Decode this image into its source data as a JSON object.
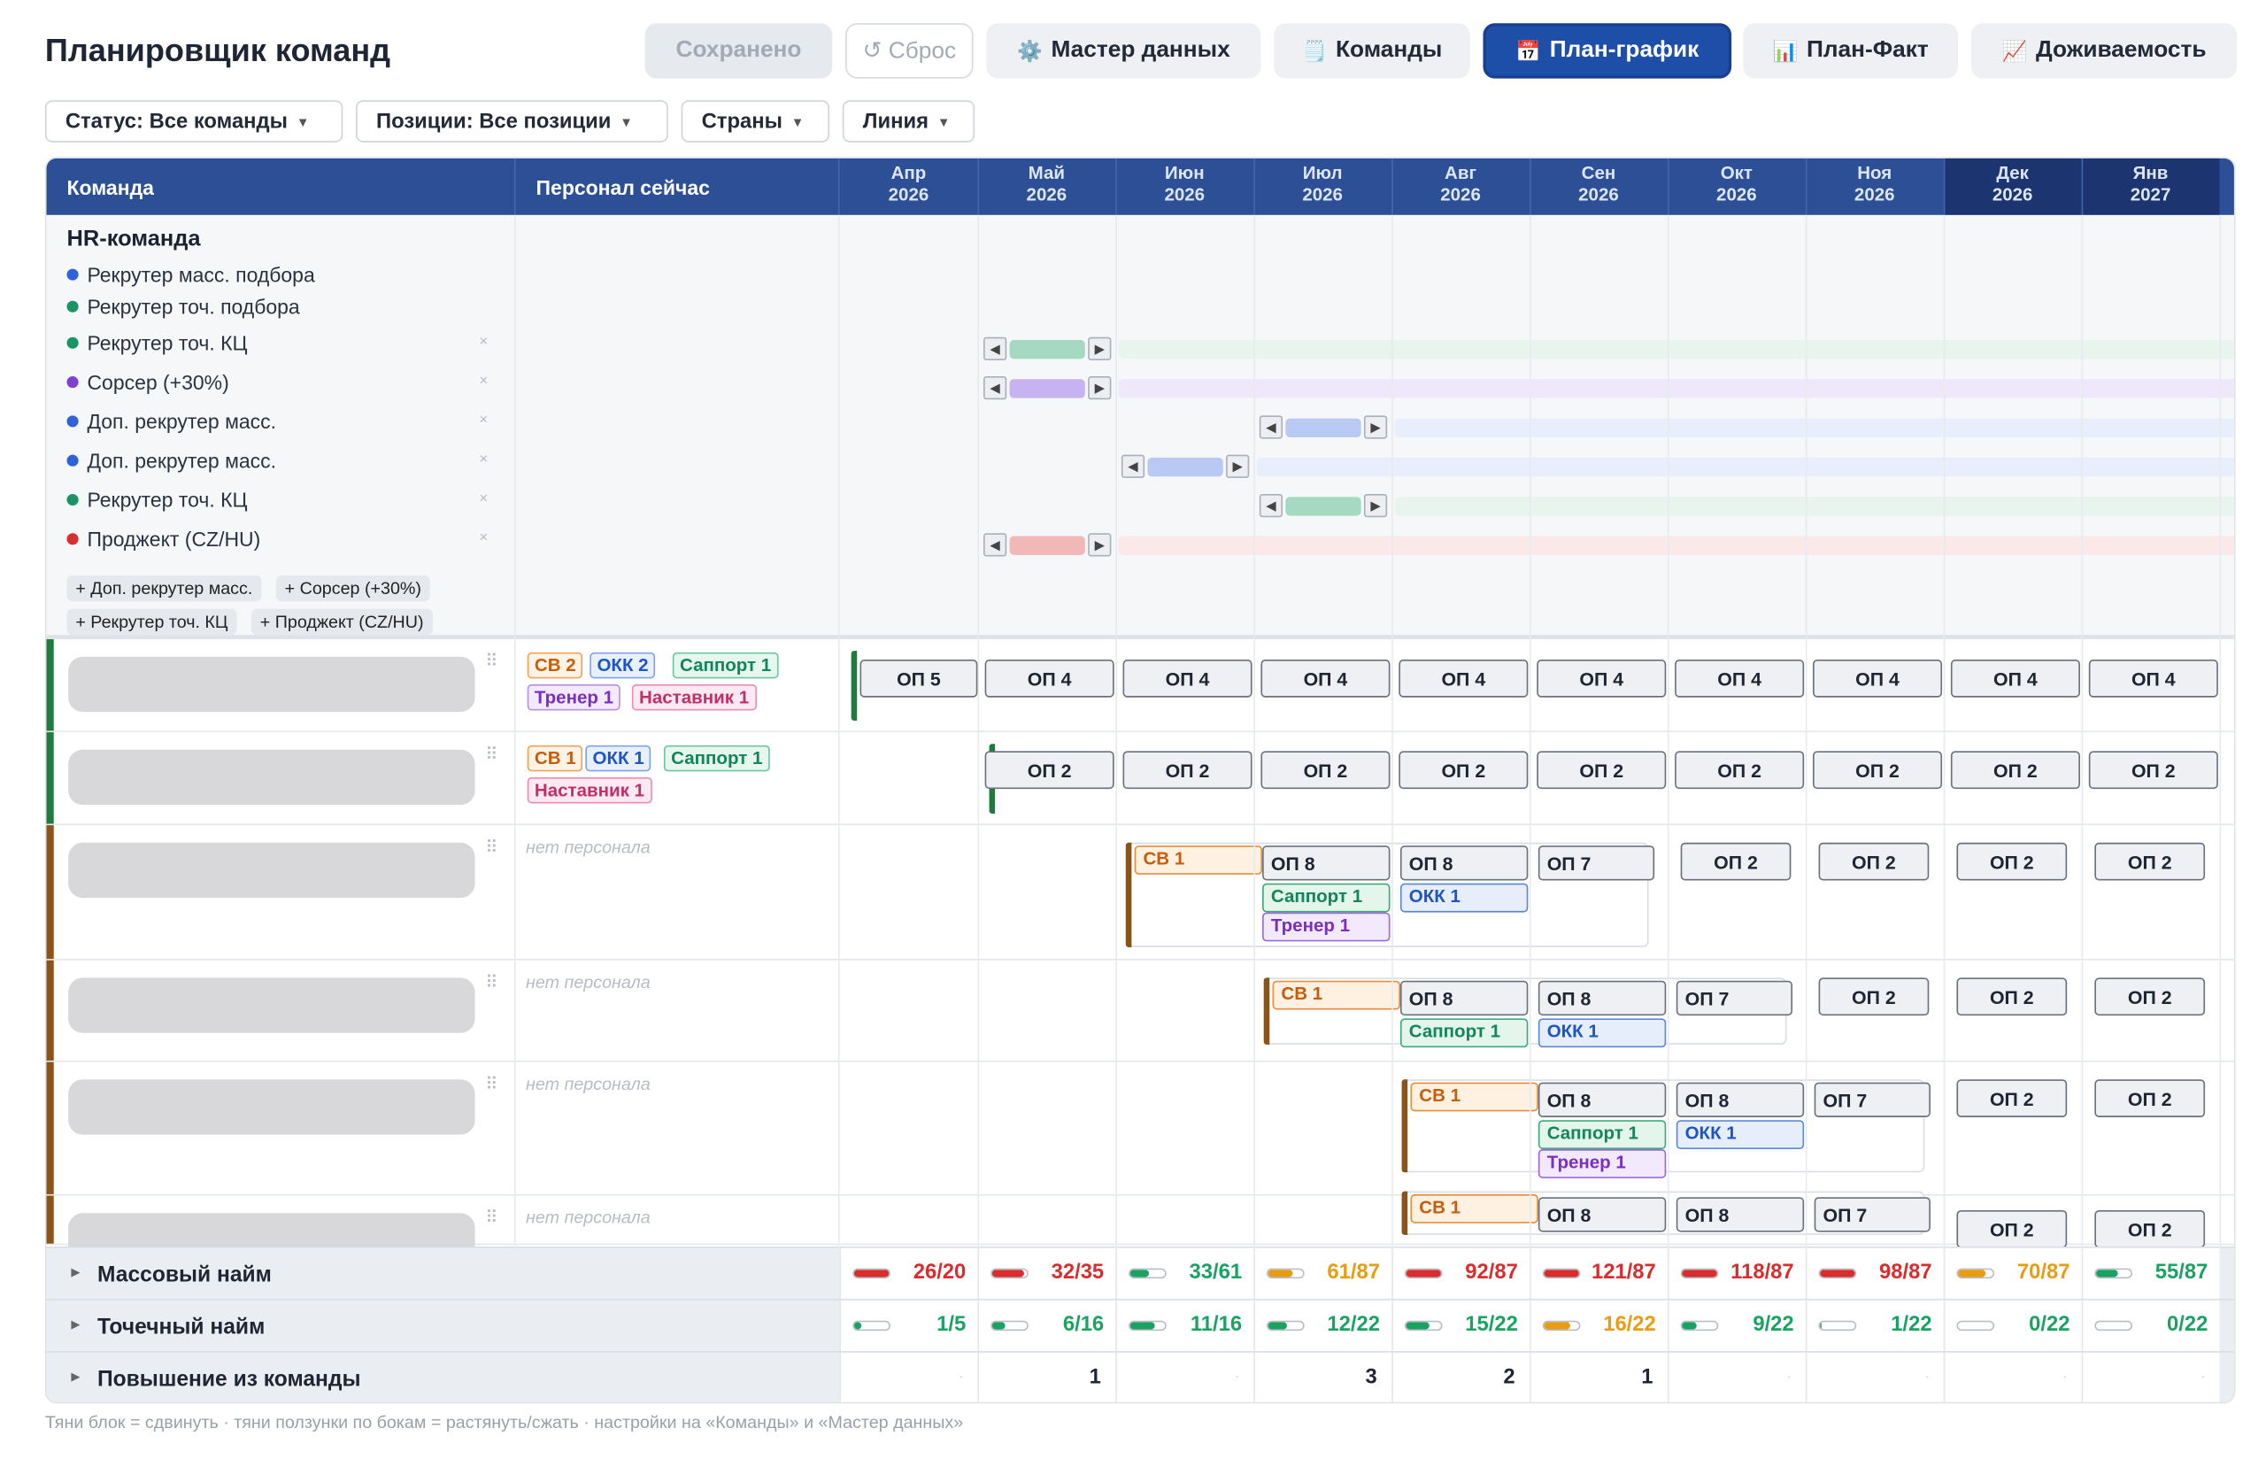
{
  "app": {
    "title": "Планировщик команд"
  },
  "toolbar": {
    "saved": "Сохранено",
    "reset": "↺ Сброс",
    "master": "Мастер данных",
    "master_icon": "⚙️",
    "teams": "Команды",
    "teams_icon": "🗒️",
    "plan": "План-график",
    "plan_icon": "📅",
    "planfact": "План-Факт",
    "planfact_icon": "📊",
    "survival": "Доживаемость",
    "survival_icon": "📈"
  },
  "filters": {
    "status": "Статус: Все команды",
    "positions": "Позиции: Все позиции",
    "countries": "Страны",
    "line": "Линия"
  },
  "table": {
    "col_team": "Команда",
    "col_staff": "Персонал сейчас"
  },
  "months": [
    {
      "m": "Апр",
      "y": "2026"
    },
    {
      "m": "Май",
      "y": "2026"
    },
    {
      "m": "Июн",
      "y": "2026"
    },
    {
      "m": "Июл",
      "y": "2026"
    },
    {
      "m": "Авг",
      "y": "2026"
    },
    {
      "m": "Сен",
      "y": "2026"
    },
    {
      "m": "Окт",
      "y": "2026"
    },
    {
      "m": "Ноя",
      "y": "2026"
    },
    {
      "m": "Дек",
      "y": "2026"
    },
    {
      "m": "Янв",
      "y": "2027"
    }
  ],
  "hr": {
    "title": "HR-команда",
    "positions": [
      {
        "label": "Рекрутер масс. подбора",
        "color": "#2f62d6",
        "removable": false
      },
      {
        "label": "Рекрутер точ. подбора",
        "color": "#1a9466",
        "removable": false
      },
      {
        "label": "Рекрутер точ. КЦ",
        "color": "#1a9466",
        "removable": true
      },
      {
        "label": "Сорсер (+30%)",
        "color": "#8040d0",
        "removable": true
      },
      {
        "label": "Доп. рекрутер масс.",
        "color": "#2f62d6",
        "removable": true
      },
      {
        "label": "Доп. рекрутер масс.",
        "color": "#2f62d6",
        "removable": true
      },
      {
        "label": "Рекрутер точ. КЦ",
        "color": "#1a9466",
        "removable": true
      },
      {
        "label": "Проджект (CZ/HU)",
        "color": "#d63030",
        "removable": true
      }
    ],
    "remove_icon": "×",
    "add_chips": [
      "+ Доп. рекрутер масс.",
      "+ Сорсер (+30%)",
      "+ Рекрутер точ. КЦ",
      "+ Проджект (CZ/HU)"
    ]
  },
  "teams": [
    {
      "staff": [
        "СВ 2",
        "ОКК 2",
        "Саппорт 1",
        "Тренер 1",
        "Наставник 1"
      ],
      "plan": [
        "ОП 5",
        "ОП 4",
        "ОП 4",
        "ОП 4",
        "ОП 4",
        "ОП 4",
        "ОП 4",
        "ОП 4",
        "ОП 4",
        "ОП 4"
      ]
    },
    {
      "staff": [
        "СВ 1",
        "ОКК 1",
        "Саппорт 1",
        "Наставник 1"
      ],
      "plan": [
        "ОП 2",
        "ОП 2",
        "ОП 2",
        "ОП 2",
        "ОП 2",
        "ОП 2",
        "ОП 2",
        "ОП 2",
        "ОП 2"
      ]
    },
    {
      "no_staff": "нет персонала",
      "ramp": [
        "СВ 1",
        "ОП 8",
        "Саппорт 1",
        "Тренер 1",
        "ОП 8",
        "ОКК 1",
        "ОП 7"
      ],
      "plan": [
        "ОП 2",
        "ОП 2",
        "ОП 2",
        "ОП 2"
      ]
    },
    {
      "no_staff": "нет персонала",
      "ramp": [
        "СВ 1",
        "ОП 8",
        "Саппорт 1",
        "ОП 8",
        "ОКК 1",
        "ОП 7"
      ],
      "plan": [
        "ОП 2",
        "ОП 2",
        "ОП 2"
      ]
    },
    {
      "no_staff": "нет персонала",
      "ramp": [
        "СВ 1",
        "ОП 8",
        "Саппорт 1",
        "Тренер 1",
        "ОП 8",
        "ОКК 1",
        "ОП 7"
      ],
      "plan": [
        "ОП 2",
        "ОП 2"
      ]
    },
    {
      "no_staff": "нет персонала",
      "ramp": [
        "СВ 1",
        "ОП 8",
        "ОП 8",
        "ОП 7"
      ],
      "plan": [
        "ОП 2",
        "ОП 2"
      ]
    }
  ],
  "summary": [
    {
      "label": "Массовый найм",
      "cells": [
        {
          "v": "26/20",
          "c": "#d92d2d",
          "f": 1
        },
        {
          "v": "32/35",
          "c": "#d92d2d",
          "f": 0.91
        },
        {
          "v": "33/61",
          "c": "#1aa262",
          "f": 0.54
        },
        {
          "v": "61/87",
          "c": "#e89c12",
          "f": 0.7
        },
        {
          "v": "92/87",
          "c": "#d92d2d",
          "f": 1
        },
        {
          "v": "121/87",
          "c": "#d92d2d",
          "f": 1
        },
        {
          "v": "118/87",
          "c": "#d92d2d",
          "f": 1
        },
        {
          "v": "98/87",
          "c": "#d92d2d",
          "f": 1
        },
        {
          "v": "70/87",
          "c": "#e89c12",
          "f": 0.8
        },
        {
          "v": "55/87",
          "c": "#1aa262",
          "f": 0.63
        }
      ]
    },
    {
      "label": "Точечный найм",
      "cells": [
        {
          "v": "1/5",
          "c": "#1aa262",
          "f": 0.2
        },
        {
          "v": "6/16",
          "c": "#1aa262",
          "f": 0.38
        },
        {
          "v": "11/16",
          "c": "#1aa262",
          "f": 0.69
        },
        {
          "v": "12/22",
          "c": "#1aa262",
          "f": 0.55
        },
        {
          "v": "15/22",
          "c": "#1aa262",
          "f": 0.68
        },
        {
          "v": "16/22",
          "c": "#e89c12",
          "f": 0.73
        },
        {
          "v": "9/22",
          "c": "#1aa262",
          "f": 0.41
        },
        {
          "v": "1/22",
          "c": "#1aa262",
          "f": 0.05
        },
        {
          "v": "0/22",
          "c": "#1aa262",
          "f": 0
        },
        {
          "v": "0/22",
          "c": "#1aa262",
          "f": 0
        }
      ]
    },
    {
      "label": "Повышение из команды",
      "cells": [
        "·",
        "1",
        "·",
        "3",
        "2",
        "1",
        "·",
        "·",
        "·",
        "·"
      ]
    }
  ],
  "footer": "Тяни блок = сдвинуть · тяни ползунки по бокам = растянуть/сжать · настройки на «Команды» и «Мастер данных»"
}
